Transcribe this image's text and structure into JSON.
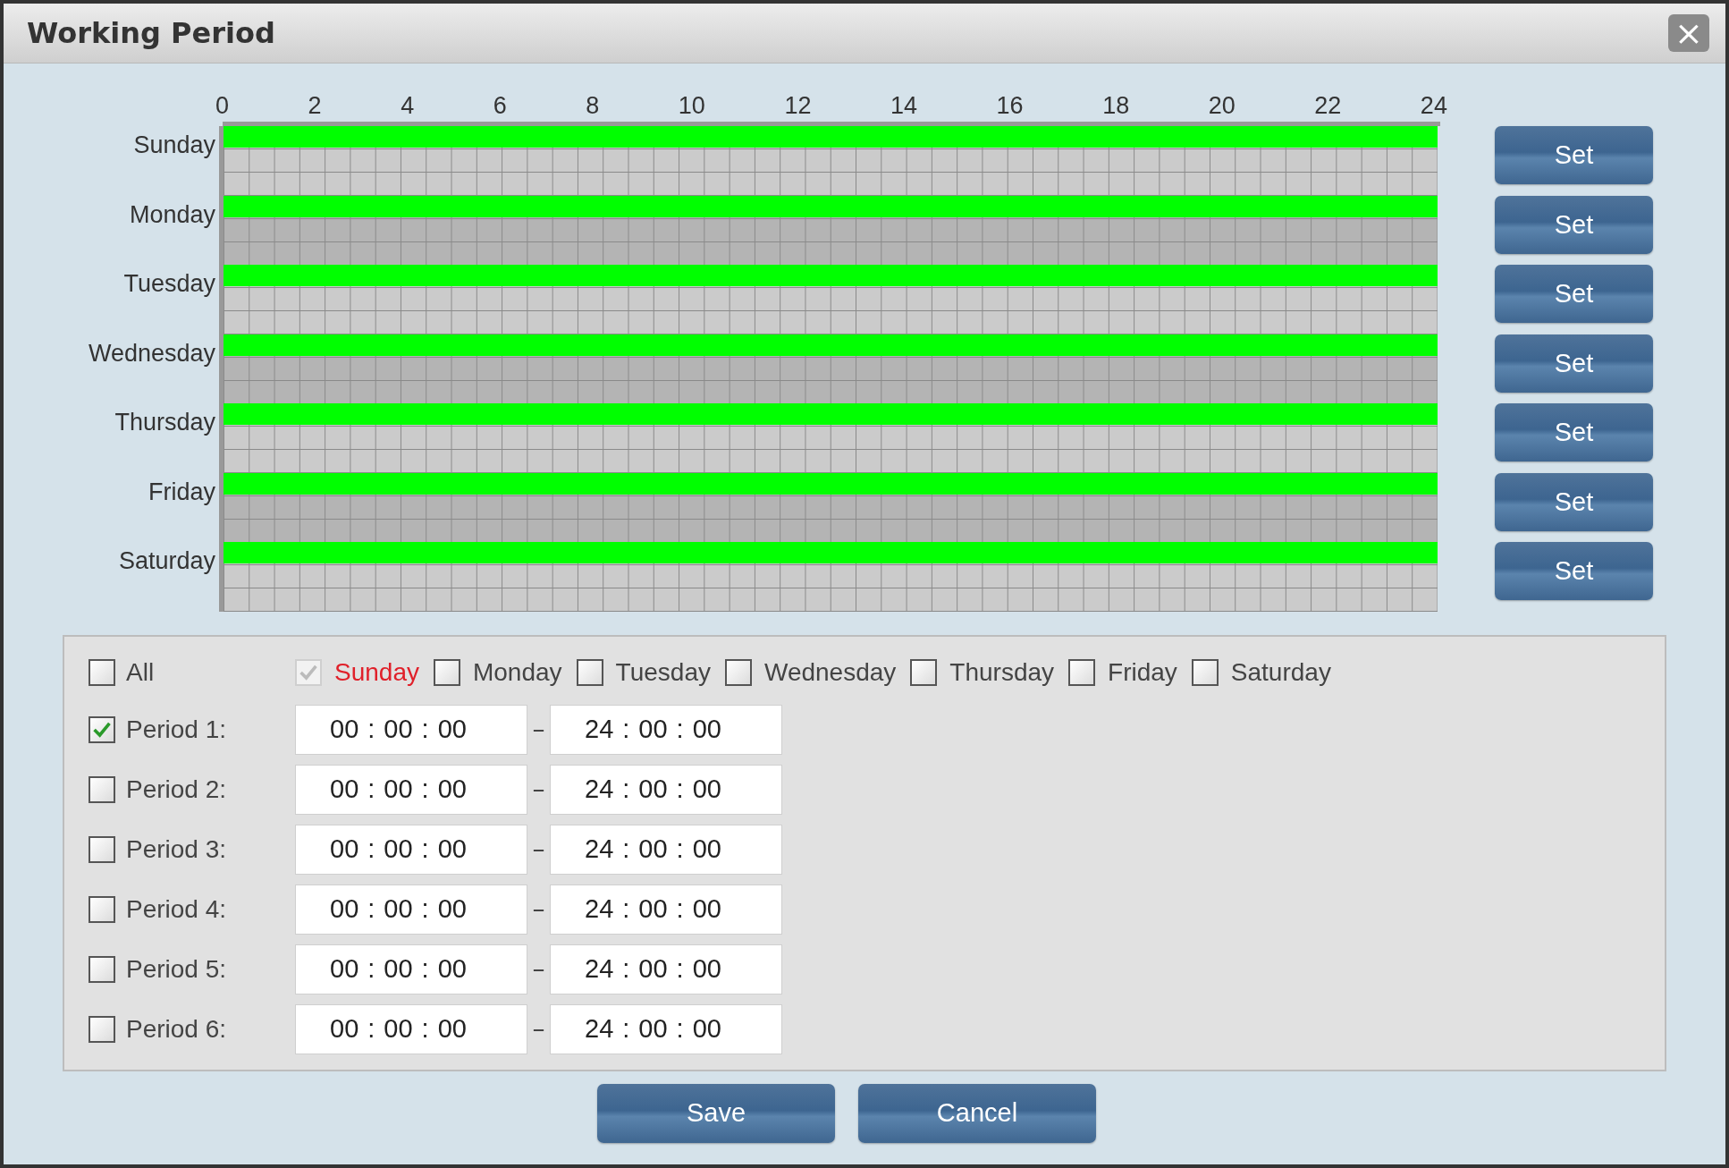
{
  "window": {
    "title": "Working Period",
    "close_glyph": "×"
  },
  "schedule": {
    "hours": [
      "0",
      "2",
      "4",
      "6",
      "8",
      "10",
      "12",
      "14",
      "16",
      "18",
      "20",
      "22",
      "24"
    ],
    "days": [
      {
        "name": "Sunday",
        "level": 1,
        "button": "Set"
      },
      {
        "name": "Monday",
        "level": 1,
        "button": "Set"
      },
      {
        "name": "Tuesday",
        "level": 1,
        "button": "Set"
      },
      {
        "name": "Wednesday",
        "level": 1,
        "button": "Set"
      },
      {
        "name": "Thursday",
        "level": 1,
        "button": "Set"
      },
      {
        "name": "Friday",
        "level": 1,
        "button": "Set"
      },
      {
        "name": "Saturday",
        "level": 1,
        "button": "Set"
      }
    ]
  },
  "period_panel": {
    "all": {
      "label": "All",
      "checked": false
    },
    "days": [
      {
        "label": "Sunday",
        "checked": true,
        "disabled": true,
        "selected": true
      },
      {
        "label": "Monday",
        "checked": false,
        "disabled": false,
        "selected": false
      },
      {
        "label": "Tuesday",
        "checked": false,
        "disabled": false,
        "selected": false
      },
      {
        "label": "Wednesday",
        "checked": false,
        "disabled": false,
        "selected": false
      },
      {
        "label": "Thursday",
        "checked": false,
        "disabled": false,
        "selected": false
      },
      {
        "label": "Friday",
        "checked": false,
        "disabled": false,
        "selected": false
      },
      {
        "label": "Saturday",
        "checked": false,
        "disabled": false,
        "selected": false
      }
    ],
    "time_separator": ":",
    "range_separator": "–",
    "periods": [
      {
        "label": "Period 1:",
        "checked": true,
        "start": [
          "00",
          "00",
          "00"
        ],
        "end": [
          "24",
          "00",
          "00"
        ]
      },
      {
        "label": "Period 2:",
        "checked": false,
        "start": [
          "00",
          "00",
          "00"
        ],
        "end": [
          "24",
          "00",
          "00"
        ]
      },
      {
        "label": "Period 3:",
        "checked": false,
        "start": [
          "00",
          "00",
          "00"
        ],
        "end": [
          "24",
          "00",
          "00"
        ]
      },
      {
        "label": "Period 4:",
        "checked": false,
        "start": [
          "00",
          "00",
          "00"
        ],
        "end": [
          "24",
          "00",
          "00"
        ]
      },
      {
        "label": "Period 5:",
        "checked": false,
        "start": [
          "00",
          "00",
          "00"
        ],
        "end": [
          "24",
          "00",
          "00"
        ]
      },
      {
        "label": "Period 6:",
        "checked": false,
        "start": [
          "00",
          "00",
          "00"
        ],
        "end": [
          "24",
          "00",
          "00"
        ]
      }
    ]
  },
  "buttons": [
    "Save",
    "Cancel"
  ]
}
